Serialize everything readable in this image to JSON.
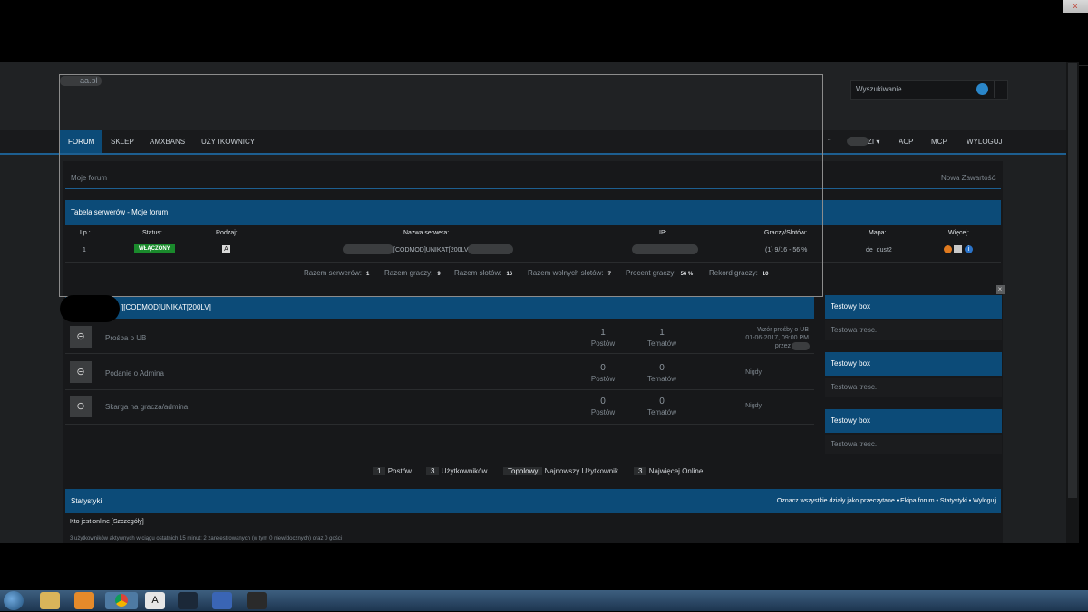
{
  "window": {
    "close_label": "x"
  },
  "header": {
    "logo_text": "aa.pl",
    "search_placeholder": "Wyszukiwanie..."
  },
  "nav": {
    "items": [
      "FORUM",
      "SKLEP",
      "AMXBANS",
      "UŻYTKOWNICY"
    ],
    "right_user": "ZI",
    "right_items": [
      "ACP",
      "MCP",
      "WYLOGUJ"
    ]
  },
  "breadcrumb": {
    "left": "Moje forum",
    "right": "Nowa Zawartość"
  },
  "servers": {
    "title": "Tabela serwerów - Moje forum",
    "columns": [
      "Lp.:",
      "Status:",
      "Rodzaj:",
      "Nazwa serwera:",
      "IP:",
      "Graczy/Slotów:",
      "Mapa:",
      "Więcej:"
    ],
    "rows": [
      {
        "lp": "1",
        "status": "WŁĄCZONY",
        "type_icon": "cs-icon",
        "name": "[CODMOD]UNIKAT[200LV]@",
        "ip": "",
        "players": "(1) 9/16 - 56 %",
        "map": "de_dust2"
      }
    ],
    "summary": [
      {
        "label": "Razem serwerów:",
        "value": "1"
      },
      {
        "label": "Razem graczy:",
        "value": "9"
      },
      {
        "label": "Razem slotów:",
        "value": "16"
      },
      {
        "label": "Razem wolnych slotów:",
        "value": "7"
      },
      {
        "label": "Procent graczy:",
        "value": "56 %"
      },
      {
        "label": "Rekord graczy:",
        "value": "10"
      }
    ]
  },
  "category": {
    "title": "][CODMOD]UNIKAT[200LV]",
    "forums": [
      {
        "title": "Prośba o UB",
        "posts": "1",
        "posts_label": "Postów",
        "topics": "1",
        "topics_label": "Tematów",
        "last1": "Wzór prośby o UB",
        "last2": "01-06-2017, 09:00 PM",
        "last3": "przez"
      },
      {
        "title": "Podanie o Admina",
        "posts": "0",
        "posts_label": "Postów",
        "topics": "0",
        "topics_label": "Tematów",
        "last1": "Nigdy"
      },
      {
        "title": "Skarga na gracza/admina",
        "posts": "0",
        "posts_label": "Postów",
        "topics": "0",
        "topics_label": "Tematów",
        "last1": "Nigdy"
      }
    ]
  },
  "sidebar": {
    "boxes": [
      {
        "title": "Testowy box",
        "body": "Testowa tresc."
      },
      {
        "title": "Testowy box",
        "body": "Testowa tresc."
      },
      {
        "title": "Testowy box",
        "body": "Testowa tresc."
      }
    ]
  },
  "stats_bar": {
    "items": [
      {
        "num": "1",
        "label": "Postów"
      },
      {
        "num": "3",
        "label": "Użytkowników"
      },
      {
        "num": "Topolowy",
        "label": "Najnowszy Użytkownik"
      },
      {
        "num": "3",
        "label": "Najwięcej Online"
      }
    ]
  },
  "statistics": {
    "title": "Statystyki",
    "links": "Oznacz wszystkie działy jako przeczytane • Ekipa forum • Statystyki • Wyloguj",
    "online_title": "Kto jest online [Szczegóły]",
    "online_desc": "3 użytkowników aktywnych w ciągu ostatnich 15 minut: 2 zarejestrowanych (w tym 0 niewidocznych) oraz 0 gości"
  },
  "taskbar": {
    "icons": [
      "start-orb",
      "explorer",
      "media-player",
      "chrome",
      "counter-strike",
      "steam",
      "calculator",
      "misc-app"
    ]
  }
}
